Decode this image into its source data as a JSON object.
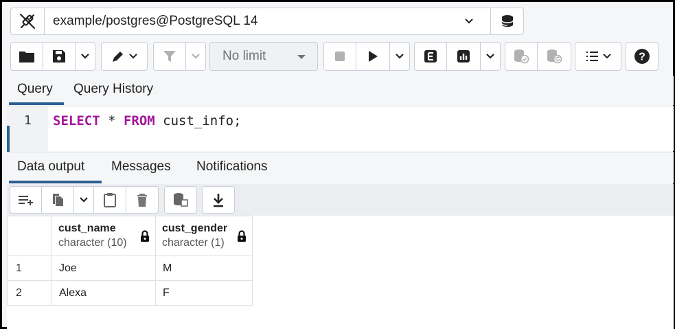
{
  "connection": {
    "label": "example/postgres@PostgreSQL 14"
  },
  "toolbar": {
    "limit_label": "No limit",
    "icons": [
      "open-file-icon",
      "save-icon",
      "chevron-down-icon",
      "edit-icon",
      "filter-icon",
      "stop-icon",
      "play-icon",
      "explain-icon",
      "explain-analyze-icon",
      "commit-icon",
      "rollback-icon",
      "macros-icon",
      "help-icon"
    ]
  },
  "query_tabs": [
    {
      "label": "Query",
      "active": true
    },
    {
      "label": "Query History",
      "active": false
    }
  ],
  "editor": {
    "line_number": "1",
    "keyword_select": "SELECT",
    "star": " * ",
    "keyword_from": "FROM",
    "rest": " cust_info;"
  },
  "output_tabs": [
    {
      "label": "Data output",
      "active": true
    },
    {
      "label": "Messages",
      "active": false
    },
    {
      "label": "Notifications",
      "active": false
    }
  ],
  "grid": {
    "columns": [
      {
        "name": "cust_name",
        "type": "character (10)"
      },
      {
        "name": "cust_gender",
        "type": "character (1)"
      }
    ],
    "rows": [
      {
        "num": "1",
        "cells": [
          "Joe",
          "M"
        ]
      },
      {
        "num": "2",
        "cells": [
          "Alexa",
          "F"
        ]
      }
    ]
  },
  "colors": {
    "accent": "#2b5f94",
    "keyword": "#a3159a"
  }
}
